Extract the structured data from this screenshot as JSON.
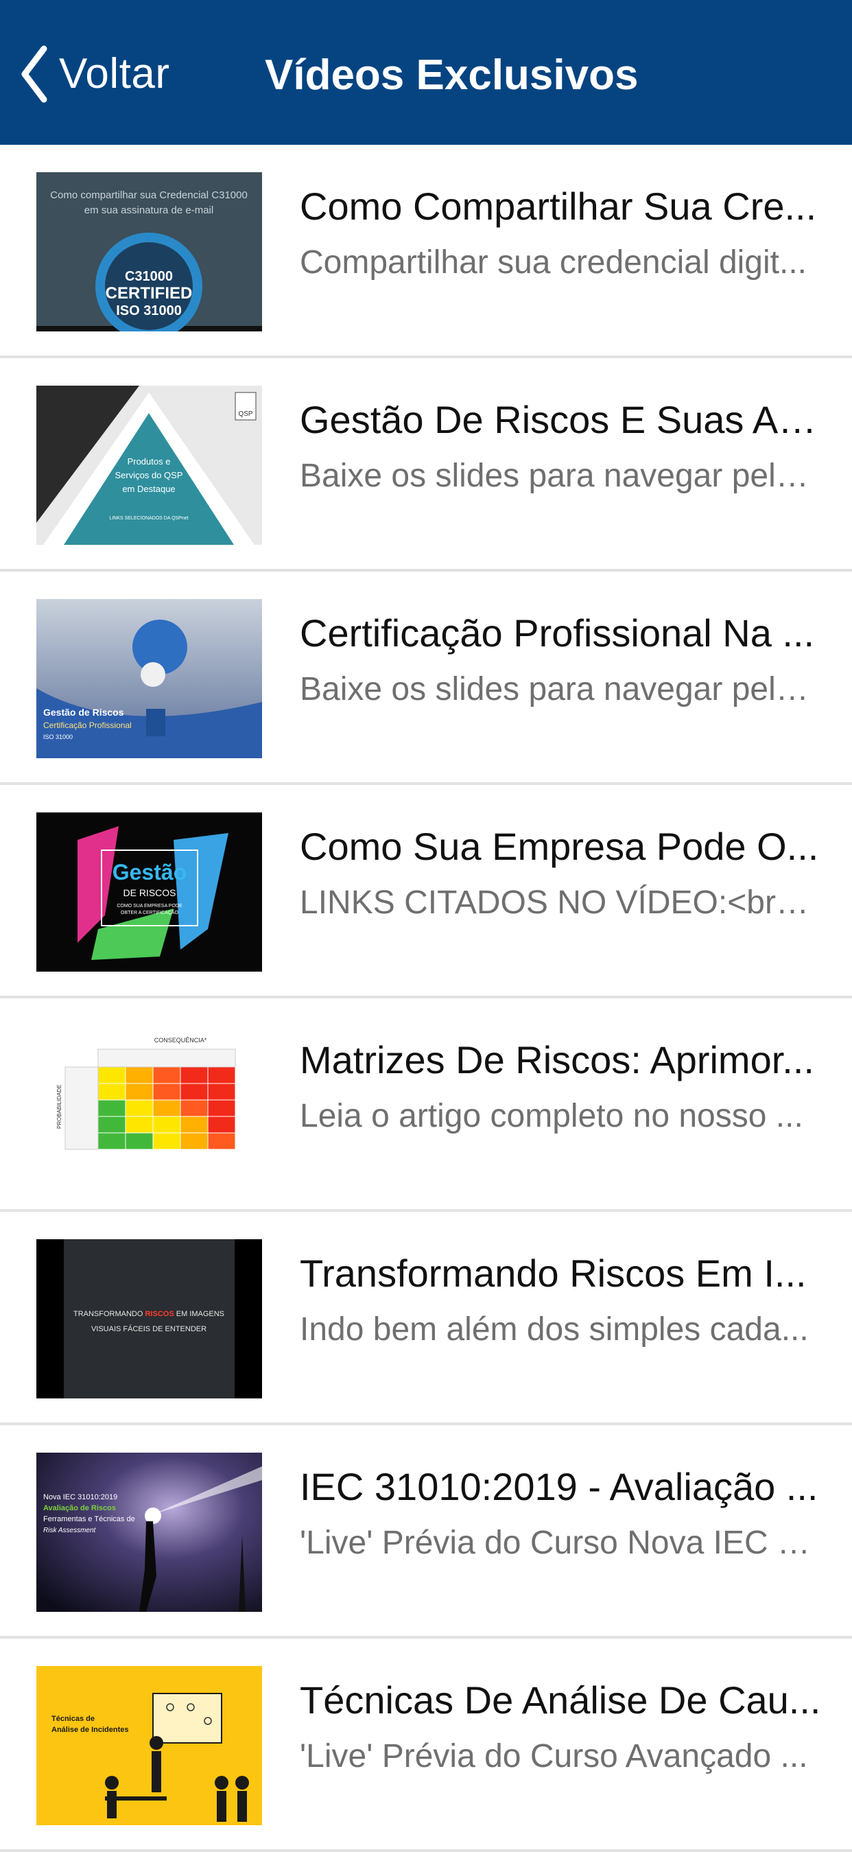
{
  "navbar": {
    "back_label": "Voltar",
    "title": "Vídeos Exclusivos",
    "back_icon": "chevron-left-icon",
    "background_color": "#054481"
  },
  "videos": [
    {
      "title": "Como Compartilhar Sua Cre...",
      "description": "Compartilhar sua credencial digit...",
      "thumb": {
        "caption_line1": "Como compartilhar sua Credencial C31000",
        "caption_line2": "em sua assinatura de e-mail",
        "badge_line1": "C31000",
        "badge_line2": "CERTIFIED",
        "badge_line3": "ISO 31000"
      }
    },
    {
      "title": "Gestão De Riscos E Suas Ap...",
      "description": "Baixe os slides para navegar pelo...",
      "thumb": {
        "line1": "Produtos e",
        "line2": "Serviços do QSP",
        "line3": "em Destaque",
        "small": "LINKS SELECIONADOS DA QSPnet",
        "logo": "QSP"
      }
    },
    {
      "title": "Certificação Profissional Na ...",
      "description": "Baixe os slides para navegar pelo...",
      "thumb": {
        "line1": "Gestão de Riscos",
        "line2": "Certificação Profissional",
        "line3": "ISO 31000"
      }
    },
    {
      "title": "Como Sua Empresa Pode O...",
      "description": "LINKS CITADOS NO VÍDEO:<br>-...",
      "thumb": {
        "line1": "Gestão",
        "line2": "DE RISCOS",
        "line3": "COMO SUA EMPRESA PODE",
        "line4": "OBTER A CERTIFICAÇÃO"
      }
    },
    {
      "title": "Matrizes De Riscos: Aprimor...",
      "description": "Leia o artigo completo no nosso ...",
      "thumb": {
        "header": "CONSEQUÊNCIA*",
        "side": "PROBABILIDADE"
      }
    },
    {
      "title": "Transformando Riscos Em I...",
      "description": "Indo bem além dos simples cada...",
      "thumb": {
        "line1a": "TRANSFORMANDO ",
        "line1b": "RISCOS",
        "line1c": " EM IMAGENS",
        "line2": "VISUAIS FÁCEIS DE ENTENDER"
      }
    },
    {
      "title": "IEC 31010:2019 - Avaliação ...",
      "description": "'Live' Prévia do Curso Nova IEC 3...",
      "thumb": {
        "line1": "Nova IEC 31010:2019",
        "line2": "Avaliação de Riscos",
        "line3": "Ferramentas e Técnicas de",
        "line4": "Risk Assessment"
      }
    },
    {
      "title": "Técnicas De Análise De Cau...",
      "description": "'Live' Prévia do Curso Avançado ...",
      "thumb": {
        "line1": "Técnicas de",
        "line2": "Análise de Incidentes"
      }
    }
  ]
}
